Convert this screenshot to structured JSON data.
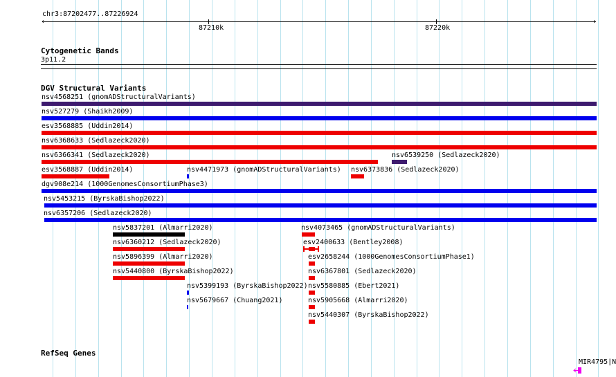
{
  "ruler": {
    "position": "chr3:87202477..87226924",
    "label_1": "87210k",
    "label_2": "87220k"
  },
  "cytobands": {
    "title": "Cytogenetic Bands",
    "band": "3p11.2"
  },
  "dgv": {
    "title": "DGV Structural Variants",
    "variants": [
      {
        "label": "nsv4568251 (gnomADStructuralVariants)",
        "color": "#3d1a6e"
      },
      {
        "label": "nsv527279 (Shaikh2009)",
        "color": "#0000ee"
      },
      {
        "label": "esv3568885 (Uddin2014)",
        "color": "#ee0000"
      },
      {
        "label": "nsv6368633 (Sedlazeck2020)",
        "color": "#ee0000"
      },
      {
        "label": "nsv6366341 (Sedlazeck2020)",
        "color": "#ee0000"
      },
      {
        "label": "nsv6539250 (Sedlazeck2020)",
        "color": "#3d1a6e"
      },
      {
        "label": "esv3568887 (Uddin2014)",
        "color": "#ee0000"
      },
      {
        "label": "nsv4471973 (gnomADStructuralVariants)",
        "color": "#0000ee"
      },
      {
        "label": "nsv6373836 (Sedlazeck2020)",
        "color": "#ee0000"
      },
      {
        "label": "dgv908e214 (1000GenomesConsortiumPhase3)",
        "color": "#0000ee"
      },
      {
        "label": "nsv5453215 (ByrskaBishop2022)",
        "color": "#0000ee"
      },
      {
        "label": "nsv6357206 (Sedlazeck2020)",
        "color": "#0000ee"
      },
      {
        "label": "nsv5837201 (Almarri2020)",
        "color": "#000000"
      },
      {
        "label": "nsv4073465 (gnomADStructuralVariants)",
        "color": "#ee0000"
      },
      {
        "label": "nsv6360212 (Sedlazeck2020)",
        "color": "#ee0000"
      },
      {
        "label": "esv2400633 (Bentley2008)",
        "color": "#ee0000"
      },
      {
        "label": "nsv5896399 (Almarri2020)",
        "color": "#ee0000"
      },
      {
        "label": "esv2658244 (1000GenomesConsortiumPhase1)",
        "color": "#ee0000"
      },
      {
        "label": "nsv5440800 (ByrskaBishop2022)",
        "color": "#ee0000"
      },
      {
        "label": "nsv6367801 (Sedlazeck2020)",
        "color": "#ee0000"
      },
      {
        "label": "nsv5399193 (ByrskaBishop2022)",
        "color": "#0000ee"
      },
      {
        "label": "nsv5580885 (Ebert2021)",
        "color": "#ee0000"
      },
      {
        "label": "nsv5679667 (Chuang2021)",
        "color": "#0000ee"
      },
      {
        "label": "nsv5905668 (Almarri2020)",
        "color": "#ee0000"
      },
      {
        "label": "nsv5440307 (ByrskaBishop2022)",
        "color": "#ee0000"
      }
    ]
  },
  "refseq": {
    "title": "RefSeq Genes",
    "gene": "MIR4795|N",
    "gene_color": "#ee00ee"
  }
}
